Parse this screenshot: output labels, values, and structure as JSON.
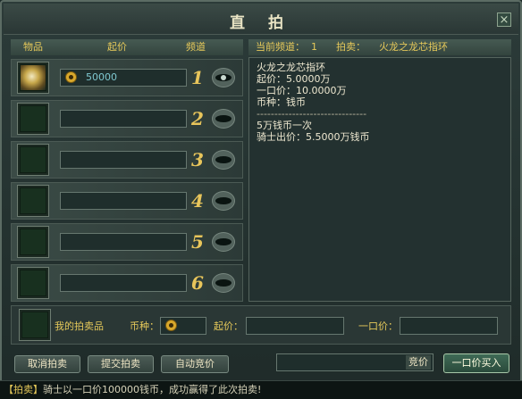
{
  "window": {
    "title": "直 拍",
    "close_label": "×"
  },
  "left_header": {
    "item": "物品",
    "start_price": "起价",
    "channel": "频道"
  },
  "right_header": {
    "current_channel_label": "当前频道：",
    "current_channel": "1",
    "auction_label": "拍卖：",
    "auction_item": "火龙之龙芯指环"
  },
  "channels": [
    {
      "number": "1",
      "price": "50000",
      "has_item": true,
      "eye_open": true
    },
    {
      "number": "2",
      "price": "",
      "has_item": false,
      "eye_open": false
    },
    {
      "number": "3",
      "price": "",
      "has_item": false,
      "eye_open": false
    },
    {
      "number": "4",
      "price": "",
      "has_item": false,
      "eye_open": false
    },
    {
      "number": "5",
      "price": "",
      "has_item": false,
      "eye_open": false
    },
    {
      "number": "6",
      "price": "",
      "has_item": false,
      "eye_open": false
    }
  ],
  "info": {
    "lines": [
      "火龙之龙芯指环",
      "起价：5.0000万",
      "一口价：10.0000万",
      "币种：钱币",
      "-------------------------------",
      "5万钱币一次",
      "骑士出价：5.5000万钱币"
    ]
  },
  "my_auction": {
    "label": "我的拍卖品",
    "currency_label": "币种：",
    "start_price_label": "起价：",
    "buyout_label": "一口价："
  },
  "buttons": {
    "cancel": "取消拍卖",
    "submit": "提交拍卖",
    "auto_bid": "自动竞价",
    "bid": "竞价",
    "buyout": "一口价买入"
  },
  "status": {
    "tag": "【拍卖】",
    "message": "骑士以一口价100000钱币，成功赢得了此次拍卖!"
  },
  "colors": {
    "accent_gold": "#e8c55b",
    "price_text": "#7ec7cf"
  }
}
